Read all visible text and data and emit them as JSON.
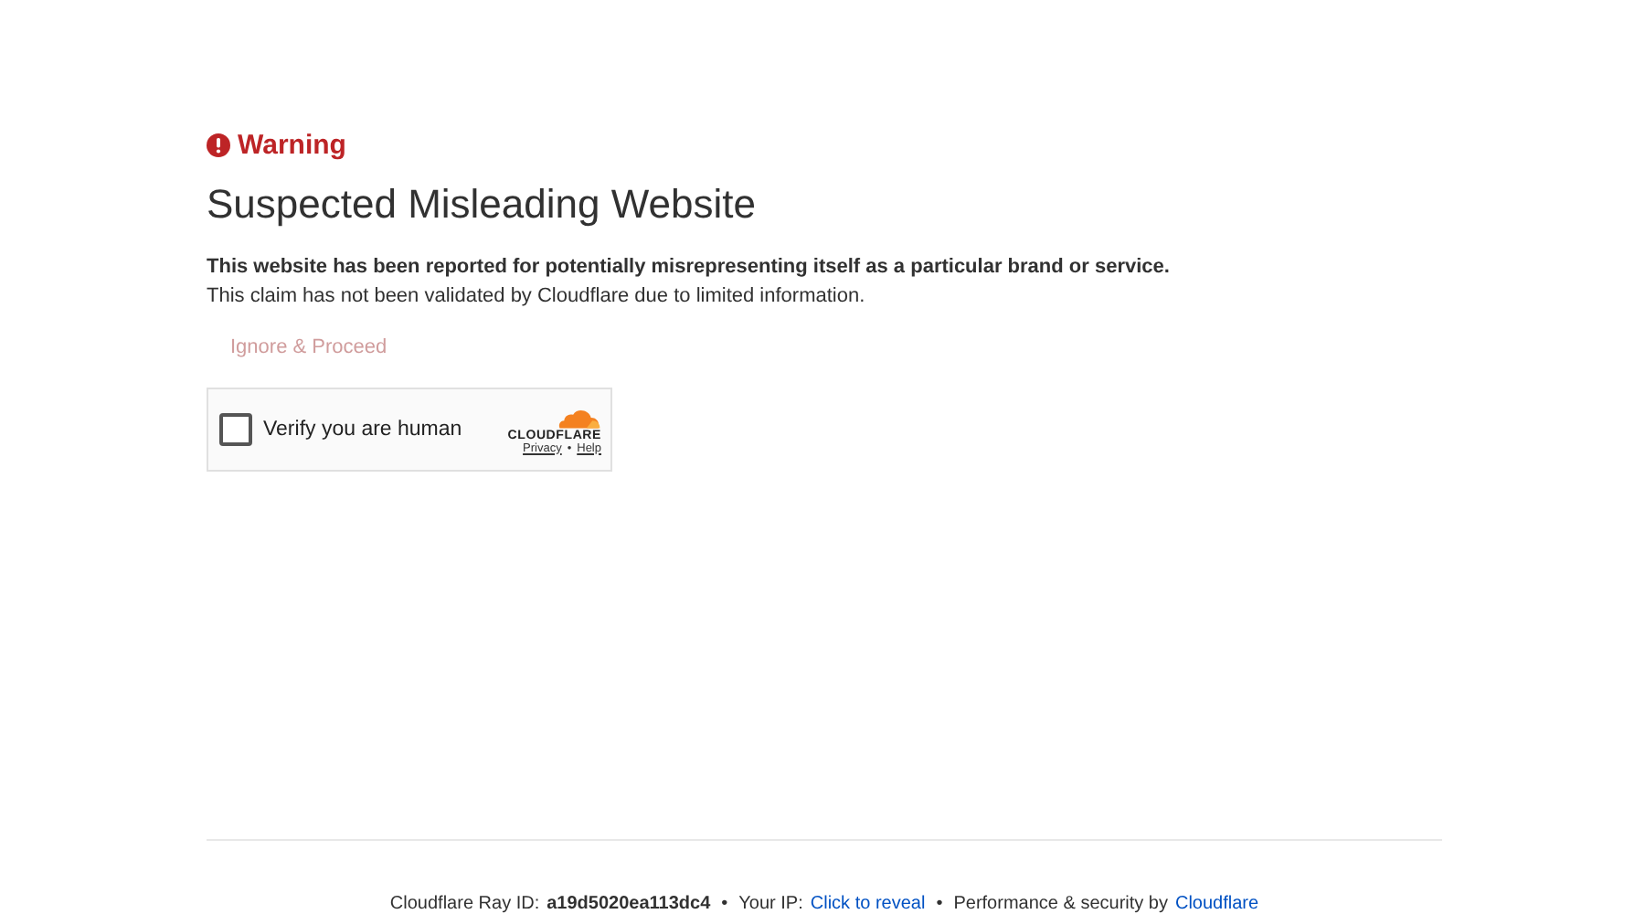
{
  "warning": "Warning",
  "heading": "Suspected Misleading Website",
  "lead": "This website has been reported for potentially misrepresenting itself as a particular brand or service.",
  "note": "This claim has not been validated by Cloudflare due to limited information.",
  "ignore_link": "Ignore & Proceed",
  "widget": {
    "label": "Verify you are human",
    "checked": false,
    "logo_text": "CLOUDFLARE",
    "links": [
      "Privacy",
      "Help"
    ],
    "separator": "•"
  },
  "footer": [
    {
      "kind": "label",
      "text": "Cloudflare Ray ID:"
    },
    {
      "kind": "strong",
      "text": "a19d5020ea113dc4"
    },
    {
      "kind": "bullet",
      "text": "•"
    },
    {
      "kind": "label",
      "text": "Your IP:"
    },
    {
      "kind": "link",
      "text": "Click to reveal"
    },
    {
      "kind": "bullet",
      "text": "•"
    },
    {
      "kind": "label",
      "text": "Performance & security by"
    },
    {
      "kind": "link",
      "text": "Cloudflare"
    }
  ]
}
